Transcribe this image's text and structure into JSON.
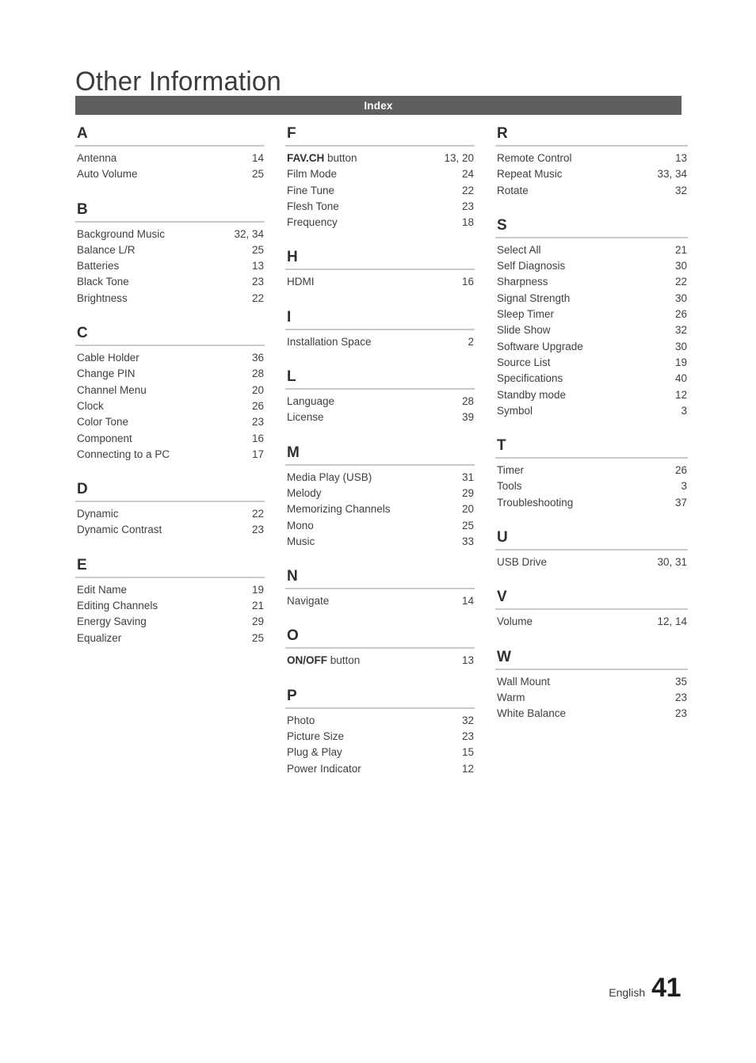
{
  "document": {
    "chapter_title": "Other Information",
    "section_banner_label": "Index",
    "banner_color": "#605f5f",
    "rule_color": "#c9cacb",
    "text_color": "#3f3f3f"
  },
  "footer": {
    "language": "English",
    "page_number": "41"
  },
  "index": {
    "columns": [
      {
        "groups": [
          {
            "letter": "A",
            "entries": [
              {
                "label": "Antenna",
                "pages": "14"
              },
              {
                "label": "Auto Volume",
                "pages": "25"
              }
            ]
          },
          {
            "letter": "B",
            "entries": [
              {
                "label": "Background Music",
                "pages": "32, 34"
              },
              {
                "label": "Balance L/R",
                "pages": "25"
              },
              {
                "label": "Batteries",
                "pages": "13"
              },
              {
                "label": "Black Tone",
                "pages": "23"
              },
              {
                "label": "Brightness",
                "pages": "22"
              }
            ]
          },
          {
            "letter": "C",
            "entries": [
              {
                "label": "Cable Holder",
                "pages": "36"
              },
              {
                "label": "Change PIN",
                "pages": "28"
              },
              {
                "label": "Channel Menu",
                "pages": "20"
              },
              {
                "label": "Clock",
                "pages": "26"
              },
              {
                "label": "Color Tone",
                "pages": "23"
              },
              {
                "label": "Component",
                "pages": "16"
              },
              {
                "label": "Connecting to a PC",
                "pages": "17"
              }
            ]
          },
          {
            "letter": "D",
            "entries": [
              {
                "label": "Dynamic",
                "pages": "22"
              },
              {
                "label": "Dynamic Contrast",
                "pages": "23"
              }
            ]
          },
          {
            "letter": "E",
            "entries": [
              {
                "label": "Edit Name",
                "pages": "19"
              },
              {
                "label": "Editing Channels",
                "pages": "21"
              },
              {
                "label": "Energy Saving",
                "pages": "29"
              },
              {
                "label": "Equalizer",
                "pages": "25"
              }
            ]
          }
        ]
      },
      {
        "groups": [
          {
            "letter": "F",
            "entries": [
              {
                "label_bold": "FAV.CH",
                "label": " button",
                "pages": "13, 20"
              },
              {
                "label": "Film Mode",
                "pages": "24"
              },
              {
                "label": "Fine Tune",
                "pages": "22"
              },
              {
                "label": "Flesh Tone",
                "pages": "23"
              },
              {
                "label": "Frequency",
                "pages": "18"
              }
            ]
          },
          {
            "letter": "H",
            "entries": [
              {
                "label": "HDMI",
                "pages": "16"
              }
            ]
          },
          {
            "letter": "I",
            "entries": [
              {
                "label": "Installation Space",
                "pages": "2"
              }
            ]
          },
          {
            "letter": "L",
            "entries": [
              {
                "label": "Language",
                "pages": "28"
              },
              {
                "label": "License",
                "pages": "39"
              }
            ]
          },
          {
            "letter": "M",
            "entries": [
              {
                "label": "Media Play (USB)",
                "pages": "31"
              },
              {
                "label": "Melody",
                "pages": "29"
              },
              {
                "label": "Memorizing Channels",
                "pages": "20"
              },
              {
                "label": "Mono",
                "pages": "25"
              },
              {
                "label": "Music",
                "pages": "33"
              }
            ]
          },
          {
            "letter": "N",
            "entries": [
              {
                "label": "Navigate",
                "pages": "14"
              }
            ]
          },
          {
            "letter": "O",
            "entries": [
              {
                "label_bold": "ON/OFF",
                "label": " button",
                "pages": "13"
              }
            ]
          },
          {
            "letter": "P",
            "entries": [
              {
                "label": "Photo",
                "pages": "32"
              },
              {
                "label": "Picture Size",
                "pages": "23"
              },
              {
                "label": "Plug & Play",
                "pages": "15"
              },
              {
                "label": "Power Indicator",
                "pages": "12"
              }
            ]
          }
        ]
      },
      {
        "groups": [
          {
            "letter": "R",
            "entries": [
              {
                "label": "Remote Control",
                "pages": "13"
              },
              {
                "label": "Repeat Music",
                "pages": "33, 34"
              },
              {
                "label": "Rotate",
                "pages": "32"
              }
            ]
          },
          {
            "letter": "S",
            "entries": [
              {
                "label": "Select All",
                "pages": "21"
              },
              {
                "label": "Self Diagnosis",
                "pages": "30"
              },
              {
                "label": "Sharpness",
                "pages": "22"
              },
              {
                "label": "Signal Strength",
                "pages": "30"
              },
              {
                "label": "Sleep Timer",
                "pages": "26"
              },
              {
                "label": "Slide Show",
                "pages": "32"
              },
              {
                "label": "Software Upgrade",
                "pages": "30"
              },
              {
                "label": "Source List",
                "pages": "19"
              },
              {
                "label": "Specifications",
                "pages": "40"
              },
              {
                "label": "Standby mode",
                "pages": "12"
              },
              {
                "label": "Symbol",
                "pages": "3"
              }
            ]
          },
          {
            "letter": "T",
            "entries": [
              {
                "label": "Timer",
                "pages": "26"
              },
              {
                "label": "Tools",
                "pages": "3"
              },
              {
                "label": "Troubleshooting",
                "pages": "37"
              }
            ]
          },
          {
            "letter": "U",
            "entries": [
              {
                "label": "USB Drive",
                "pages": "30, 31"
              }
            ]
          },
          {
            "letter": "V",
            "entries": [
              {
                "label": "Volume",
                "pages": "12, 14"
              }
            ]
          },
          {
            "letter": "W",
            "entries": [
              {
                "label": "Wall Mount",
                "pages": "35"
              },
              {
                "label": "Warm",
                "pages": "23"
              },
              {
                "label": "White Balance",
                "pages": "23"
              }
            ]
          }
        ]
      }
    ]
  }
}
